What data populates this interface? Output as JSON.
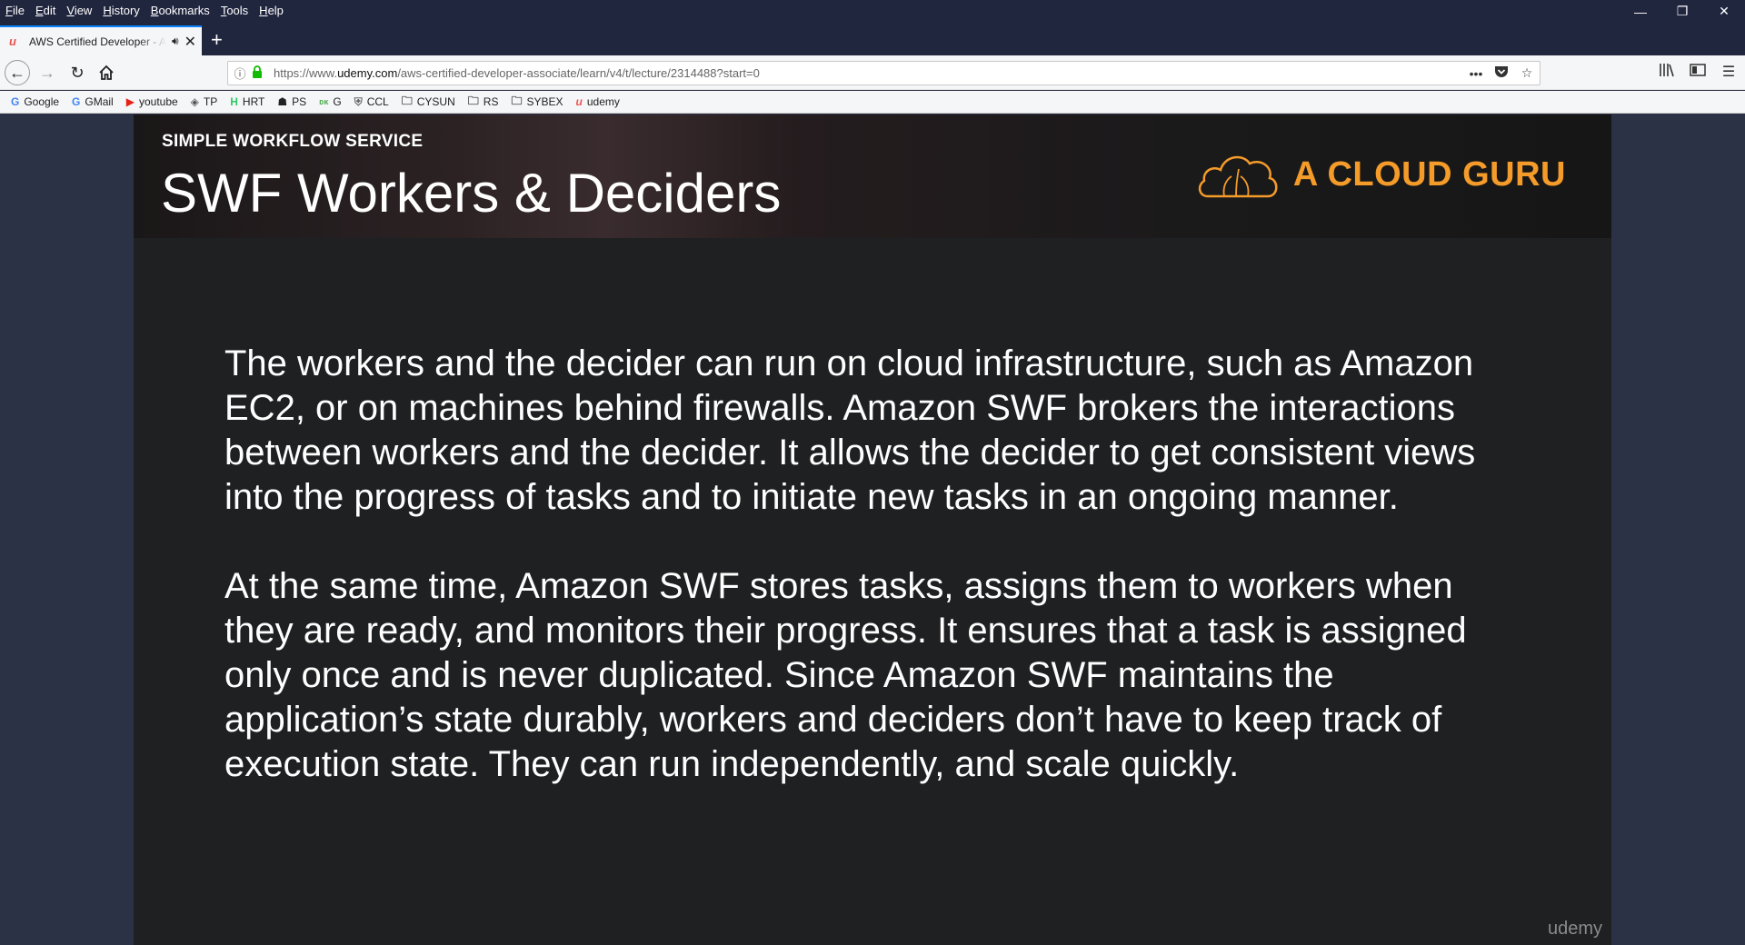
{
  "menu": [
    "File",
    "Edit",
    "View",
    "History",
    "Bookmarks",
    "Tools",
    "Help"
  ],
  "window_controls": {
    "minimize": "—",
    "restore": "❐",
    "close": "✕"
  },
  "tab": {
    "favicon": "u",
    "title": "AWS Certified Developer - A",
    "audio_icon": "speaker-icon",
    "close": "✕"
  },
  "new_tab": "+",
  "nav": {
    "url_prefix": "https://www.",
    "url_domain": "udemy.com",
    "url_path": "/aws-certified-developer-associate/learn/v4/t/lecture/2314488?start=0",
    "page_actions": "•••"
  },
  "bookmarks": [
    {
      "label": "Google",
      "icon": "G",
      "color": "#4285f4"
    },
    {
      "label": "GMail",
      "icon": "G",
      "color": "#4285f4"
    },
    {
      "label": "youtube",
      "icon": "▶",
      "color": "#e62117"
    },
    {
      "label": "TP",
      "icon": "◈",
      "color": "#555"
    },
    {
      "label": "HRT",
      "icon": "H",
      "color": "#2ec866"
    },
    {
      "label": "PS",
      "icon": "☗",
      "color": "#222"
    },
    {
      "label": "G",
      "icon": "ᴅᴋ",
      "color": "#4caf50"
    },
    {
      "label": "CCL",
      "icon": "⛨",
      "color": "#666"
    },
    {
      "label": "CYSUN",
      "icon": "🗀",
      "color": "#444"
    },
    {
      "label": "RS",
      "icon": "🗀",
      "color": "#444"
    },
    {
      "label": "SYBEX",
      "icon": "🗀",
      "color": "#444"
    },
    {
      "label": "udemy",
      "icon": "u",
      "color": "#ec5252"
    }
  ],
  "slide": {
    "kicker": "SIMPLE WORKFLOW SERVICE",
    "title": "SWF Workers & Deciders",
    "brand": "A CLOUD GURU",
    "paragraphs": [
      "The workers and the decider can run on cloud infrastructure, such as Amazon EC2, or on machines behind firewalls. Amazon SWF brokers the interactions between workers and the decider. It allows the decider to get consistent views into the progress of tasks and to initiate new tasks in an ongoing manner.",
      "At the same time, Amazon SWF stores tasks, assigns them to workers when they are ready, and monitors their progress. It ensures that a task is assigned only once and is never duplicated. Since Amazon SWF maintains the application’s state durably, workers and deciders don’t have to keep track of execution state. They can run independently, and scale quickly."
    ],
    "watermark": "udemy"
  },
  "colors": {
    "brand_orange": "#f49b2a",
    "browser_dark": "#21263f",
    "slide_bg": "#1f2021",
    "page_bg": "#2b3245"
  }
}
